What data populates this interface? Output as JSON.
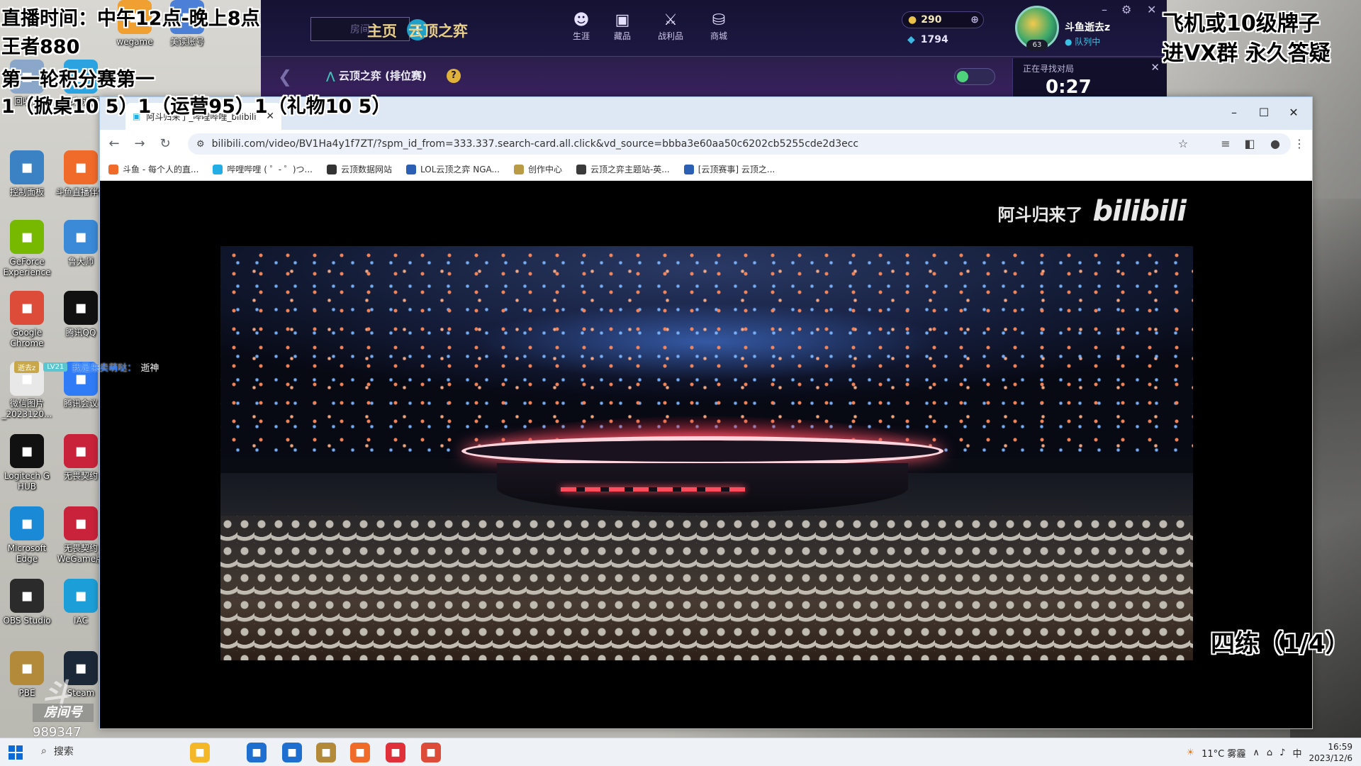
{
  "overlay": {
    "schedule": "直播时间：中午12点-晚上8点",
    "rank": "王者880",
    "round": "第一轮积分赛第一",
    "scores": "1（掀桌10 5）1（运营95）1（礼物10 5）",
    "promo_line1": "飞机或10级牌子",
    "promo_line2": "进VX群 永久答疑",
    "practice": "四练（1/4）",
    "room_label": "房间号",
    "room_number": "989347"
  },
  "desktop": {
    "icons": [
      {
        "label": "回收站",
        "icon": "recycle-bin-icon",
        "color": "#8aa6c8"
      },
      {
        "label": "UU加速器",
        "icon": "uu-accelerator-icon",
        "color": "#2aa3e0"
      },
      {
        "label": "wegame",
        "icon": "wegame-icon",
        "color": "#f0a030"
      },
      {
        "label": "美读账号",
        "icon": "account-icon",
        "color": "#4c7fd6"
      },
      {
        "label": "控制面板",
        "icon": "control-panel-icon",
        "color": "#3b82c4"
      },
      {
        "label": "斗鱼直播伴侣",
        "icon": "douyu-icon",
        "color": "#f06a2a"
      },
      {
        "label": "GeForce Experience",
        "icon": "geforce-icon",
        "color": "#76b900"
      },
      {
        "label": "鲁大师",
        "icon": "ludashi-icon",
        "color": "#3a8ad8"
      },
      {
        "label": "Google Chrome",
        "icon": "chrome-icon",
        "color": "#dd4b39"
      },
      {
        "label": "腾讯QQ",
        "icon": "qq-icon",
        "color": "#111111"
      },
      {
        "label": "微信图片_2023120...",
        "icon": "image-file-icon",
        "color": "#e8e8e8"
      },
      {
        "label": "腾讯会议",
        "icon": "tencent-meeting-icon",
        "color": "#2f7cf6"
      },
      {
        "label": "Logitech G HUB",
        "icon": "logitech-icon",
        "color": "#111111"
      },
      {
        "label": "无畏契约",
        "icon": "valorant-icon",
        "color": "#c8233b"
      },
      {
        "label": "Microsoft Edge",
        "icon": "edge-icon",
        "color": "#1b8ad6"
      },
      {
        "label": "无畏契约WeGame版",
        "icon": "valorant-wegame-icon",
        "color": "#c8233b"
      },
      {
        "label": "OBS Studio",
        "icon": "obs-icon",
        "color": "#2b2b2b"
      },
      {
        "label": "IAC",
        "icon": "iac-icon",
        "color": "#1c9fd8"
      },
      {
        "label": "PBE",
        "icon": "lol-pbe-icon",
        "color": "#b38a3a"
      },
      {
        "label": "Steam",
        "icon": "steam-icon",
        "color": "#1b2838"
      }
    ]
  },
  "game_client": {
    "search_placeholder": "房间",
    "nav": [
      "主页",
      "云顶之弈"
    ],
    "icons": [
      {
        "label": "生涯",
        "icon": "career-icon"
      },
      {
        "label": "藏品",
        "icon": "collection-icon"
      },
      {
        "label": "战利品",
        "icon": "loot-icon"
      },
      {
        "label": "商城",
        "icon": "store-icon"
      }
    ],
    "currency1": "290",
    "currency2": "1794",
    "username": "斗鱼逝去z",
    "status": "队列中",
    "level": "63",
    "mode": "云顶之弈 (排位赛)",
    "queue_label": "正在寻找对局",
    "queue_timer": "0:27"
  },
  "browser": {
    "tab_title": "阿斗归来了_哔哩哔哩_bilibili",
    "url": "bilibili.com/video/BV1Ha4y1f7ZT/?spm_id_from=333.337.search-card.all.click&vd_source=bbba3e60aa50c6202cb5255cde2d3ecc",
    "bookmarks": [
      {
        "label": "斗鱼 - 每个人的直...",
        "color": "#f06a2a"
      },
      {
        "label": "哔哩哔哩 ( ゜- ゜)つ...",
        "color": "#23ade5"
      },
      {
        "label": "云顶数据网站",
        "color": "#333333"
      },
      {
        "label": "LOL云顶之弈 NGA...",
        "color": "#2b5fb3"
      },
      {
        "label": "创作中心",
        "color": "#b89b44"
      },
      {
        "label": "云顶之弈主题站-英...",
        "color": "#3a3a3a"
      },
      {
        "label": "[云顶赛事] 云顶之...",
        "color": "#2b5fb3"
      }
    ],
    "video_watermark_text": "阿斗归来了",
    "video_watermark_logo": "bilibili"
  },
  "danmaku": {
    "badge1": "逝去z",
    "badge2": "LV21",
    "user": "我是来卖萌哒：",
    "message": "逝神"
  },
  "taskbar": {
    "search_label": "搜索",
    "apps": [
      {
        "name": "file-manager",
        "color": "#f3b728"
      },
      {
        "name": "store",
        "color": "#1f6fd1"
      },
      {
        "name": "mail",
        "color": "#1f6fd1"
      },
      {
        "name": "lol",
        "color": "#b38a3a"
      },
      {
        "name": "douyu",
        "color": "#f06a2a"
      },
      {
        "name": "netease-music",
        "color": "#e0303a"
      },
      {
        "name": "chrome",
        "color": "#dd4b39"
      }
    ],
    "weather": "11°C 雾霾",
    "ime": "中",
    "time": "16:59",
    "date": "2023/12/6"
  }
}
